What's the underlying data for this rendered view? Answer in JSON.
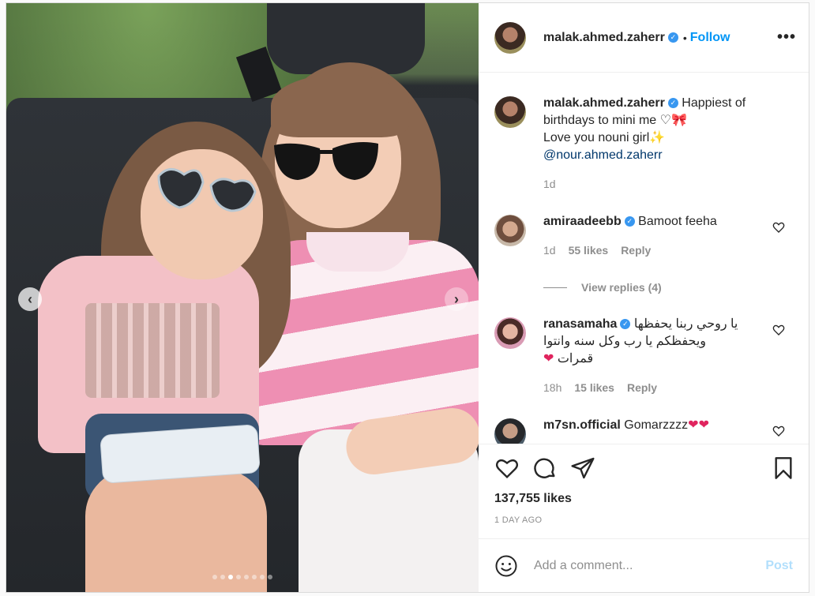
{
  "post": {
    "author": "malak.ahmed.zaherr",
    "separator": "•",
    "follow_label": "Follow",
    "more_label": "•••",
    "verified_mark": "✓"
  },
  "media": {
    "prev_label": "‹",
    "next_label": "›",
    "carousel_count": 8,
    "carousel_active_index": 2
  },
  "caption": {
    "username": "malak.ahmed.zaherr",
    "line1": " Happiest of birthdays to mini me ♡🎀",
    "line2": "Love you nouni girl✨",
    "mention": "@nour.ahmed.zaherr",
    "time": "1d"
  },
  "comments": [
    {
      "username": "amiraadeebb",
      "text": " Bamoot feeha",
      "time": "1d",
      "likes": "55 likes",
      "reply": "Reply",
      "view_replies": "View replies (4)"
    },
    {
      "username": "ranasamaha",
      "text_ar_1": "يا روحي ربنا يحفظها",
      "text_ar_2": "ويحفظكم يا رب وكل سنه وانتوا",
      "text_ar_3": "قمرات",
      "heart": "❤",
      "time": "18h",
      "likes": "15 likes",
      "reply": "Reply"
    },
    {
      "username": "m7sn.official",
      "text": " Gomarzzzz",
      "hearts": "❤❤"
    }
  ],
  "actions": {
    "likes": "137,755 likes",
    "time": "1 DAY AGO"
  },
  "add_comment": {
    "placeholder": "Add a comment...",
    "post_label": "Post"
  },
  "colors": {
    "accent": "#0095f6",
    "verified": "#3897f0",
    "post_disabled": "#b2dffc",
    "muted": "#8e8e8e",
    "mention": "#00376b"
  }
}
